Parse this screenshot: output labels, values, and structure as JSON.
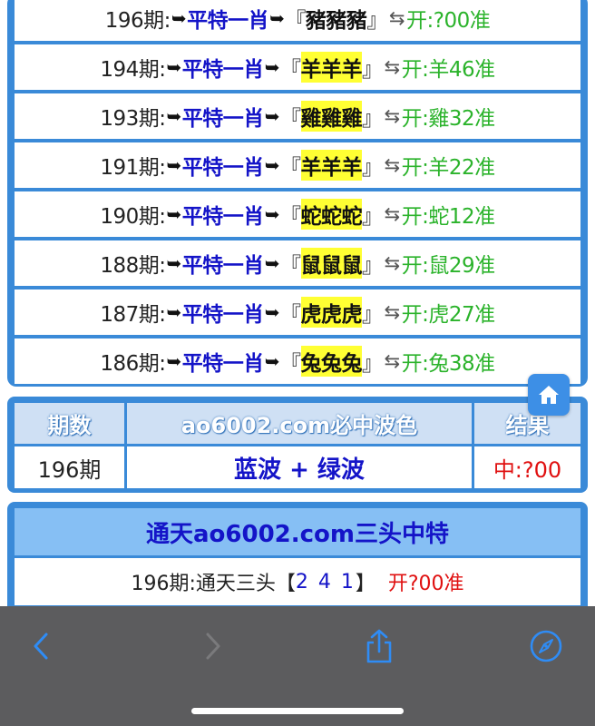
{
  "rows": [
    {
      "period": "196期:",
      "ping": "平特一肖",
      "lb": "『",
      "zodiac": "豬豬豬",
      "rb": "』",
      "open": "开:?00准",
      "highlight": false
    },
    {
      "period": "194期:",
      "ping": "平特一肖",
      "lb": "『",
      "zodiac": "羊羊羊",
      "rb": "』",
      "open": "开:羊46准",
      "highlight": true
    },
    {
      "period": "193期:",
      "ping": "平特一肖",
      "lb": "『",
      "zodiac": "雞雞雞",
      "rb": "』",
      "open": "开:雞32准",
      "highlight": true
    },
    {
      "period": "191期:",
      "ping": "平特一肖",
      "lb": "『",
      "zodiac": "羊羊羊",
      "rb": "』",
      "open": "开:羊22准",
      "highlight": true
    },
    {
      "period": "190期:",
      "ping": "平特一肖",
      "lb": "『",
      "zodiac": "蛇蛇蛇",
      "rb": "』",
      "open": "开:蛇12准",
      "highlight": true
    },
    {
      "period": "188期:",
      "ping": "平特一肖",
      "lb": "『",
      "zodiac": "鼠鼠鼠",
      "rb": "』",
      "open": "开:鼠29准",
      "highlight": true
    },
    {
      "period": "187期:",
      "ping": "平特一肖",
      "lb": "『",
      "zodiac": "虎虎虎",
      "rb": "』",
      "open": "开:虎27准",
      "highlight": true
    },
    {
      "period": "186期:",
      "ping": "平特一肖",
      "lb": "『",
      "zodiac": "兔兔兔",
      "rb": "』",
      "open": "开:兔38准",
      "highlight": true
    }
  ],
  "arrow_glyph": "➥",
  "swap_glyph": "⇆",
  "color_table": {
    "headers": [
      "期数",
      "ao6002.com必中波色",
      "结果"
    ],
    "cells": [
      "196期",
      "蓝波 + 绿波",
      "中:?00"
    ],
    "result_color": "#e01010",
    "colors_text_color": "#1414c8"
  },
  "sanTou": {
    "title": "通天ao6002.com三头中特",
    "row": {
      "prefix": "196期:通天三头【",
      "numbers": "2 4 1",
      "suffix": "】",
      "result": "开?00准"
    },
    "numbers_color": "#1414c8",
    "result_color": "#e01010"
  },
  "icons": {
    "home": "home-icon",
    "back": "chevron-left-icon",
    "forward": "chevron-right-icon",
    "share": "share-icon",
    "compass": "compass-icon"
  },
  "colors": {
    "frame_blue": "#3a8ad8",
    "ping_blue": "#1414c8",
    "open_green": "#2bb32b",
    "highlight_yellow": "#ffff33",
    "toolbar_gray": "#5c5c5e",
    "toolbar_icon_blue": "#2f8cf5"
  }
}
